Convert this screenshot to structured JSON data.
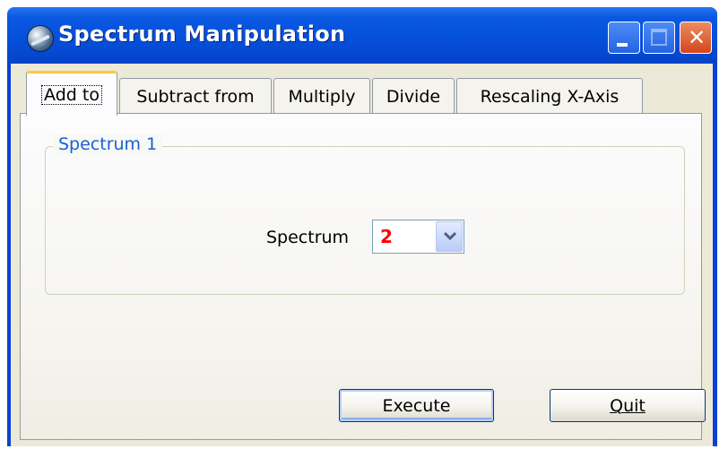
{
  "window": {
    "title": "Spectrum Manipulation"
  },
  "tabs": [
    {
      "label": "Add to",
      "active": true
    },
    {
      "label": "Subtract from",
      "active": false
    },
    {
      "label": "Multiply",
      "active": false
    },
    {
      "label": "Divide",
      "active": false
    },
    {
      "label": "Rescaling X-Axis",
      "active": false
    }
  ],
  "group": {
    "legend": "Spectrum 1",
    "spectrum_label": "Spectrum",
    "spectrum_value": "2"
  },
  "buttons": {
    "execute": "Execute",
    "quit": "Quit"
  },
  "colors": {
    "titlebar": "#0650dc",
    "group_legend": "#1a5fd6",
    "spectrum_value": "#ff0000",
    "active_tab_highlight": "#ffc83c"
  },
  "icons": {
    "app": "spectrum-app-icon",
    "minimize": "minimize-icon",
    "maximize": "maximize-icon",
    "close": "close-icon",
    "dropdown": "chevron-down-icon"
  }
}
